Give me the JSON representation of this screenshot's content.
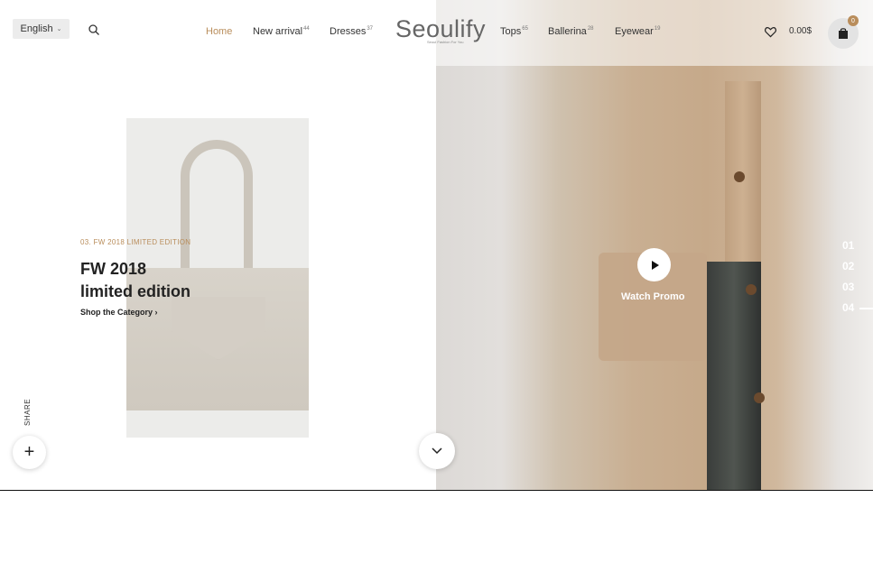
{
  "header": {
    "language": "English",
    "nav": [
      {
        "label": "Home",
        "count": ""
      },
      {
        "label": "New arrival",
        "count": "44"
      },
      {
        "label": "Dresses",
        "count": "37"
      },
      {
        "label": "Tops",
        "count": "65"
      },
      {
        "label": "Ballerina",
        "count": "28"
      },
      {
        "label": "Eyewear",
        "count": "19"
      }
    ],
    "logo": "Seoulify",
    "logo_tagline": "Seoul Fashion For You",
    "cart_total": "0.00$",
    "cart_count": "0"
  },
  "hero": {
    "eyebrow": "03. FW 2018 LIMITED EDITION",
    "title_line1": "FW 2018",
    "title_line2": "limited edition",
    "cta": "Shop the Category",
    "promo_label": "Watch Promo",
    "slides": [
      "01",
      "02",
      "03",
      "04"
    ]
  },
  "sidebar": {
    "share_label": "SHARE"
  },
  "colors": {
    "accent": "#b98d5b"
  },
  "icons": [
    "search-icon",
    "heart-icon",
    "shopping-bag-icon",
    "play-icon",
    "plus-icon",
    "chevron-down-icon",
    "chevron-right-icon"
  ]
}
